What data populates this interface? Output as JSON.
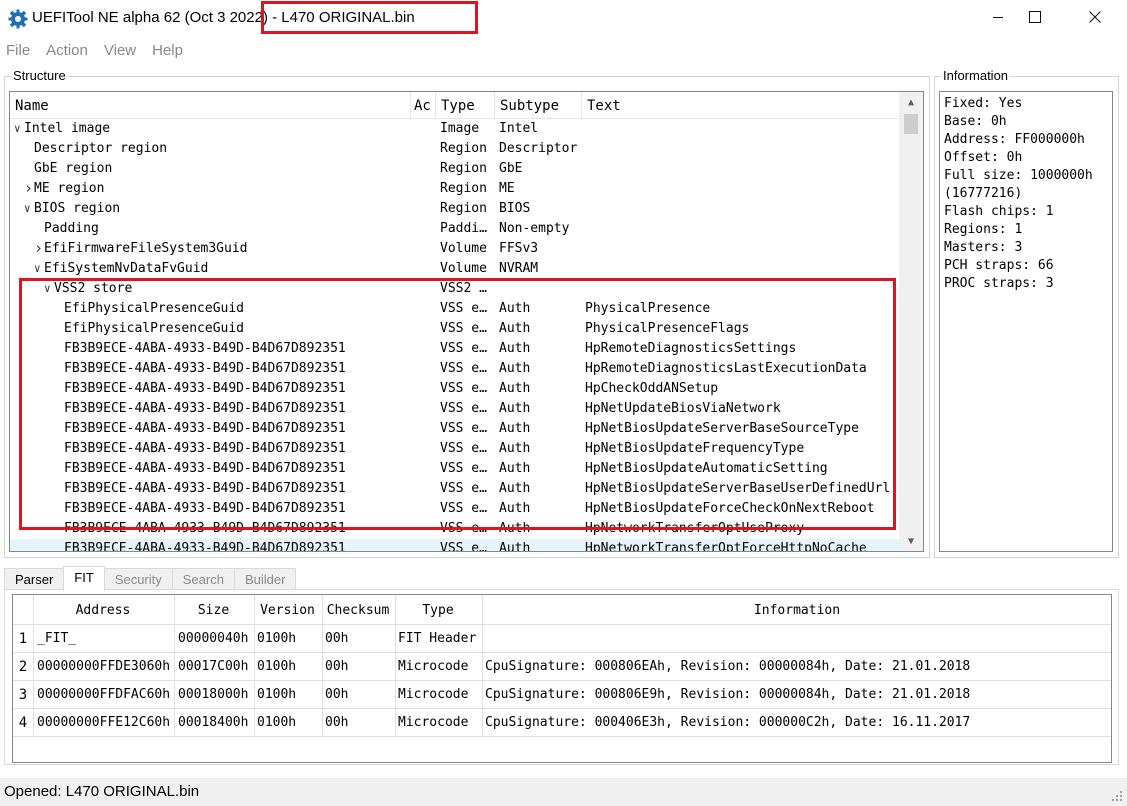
{
  "window": {
    "app_title": "UEFITool NE alpha 62 (Oct  3 2022)",
    "file_suffix": " - L470 ORIGINAL.bin"
  },
  "menu": [
    "File",
    "Action",
    "View",
    "Help"
  ],
  "structure": {
    "group_label": "Structure",
    "columns": [
      "Name",
      "Ac",
      "Type",
      "Subtype",
      "Text"
    ],
    "rows": [
      {
        "arrow": "v",
        "name": "Intel image",
        "type": "Image",
        "subtype": "Intel",
        "text": ""
      },
      {
        "arrow": "",
        "name": "Descriptor region",
        "type": "Region",
        "subtype": "Descriptor",
        "text": ""
      },
      {
        "arrow": "",
        "name": "GbE region",
        "type": "Region",
        "subtype": "GbE",
        "text": ""
      },
      {
        "arrow": ">",
        "name": "ME region",
        "type": "Region",
        "subtype": "ME",
        "text": ""
      },
      {
        "arrow": "v",
        "name": "BIOS region",
        "type": "Region",
        "subtype": "BIOS",
        "text": ""
      },
      {
        "arrow": "",
        "name": "Padding",
        "type": "Paddi…",
        "subtype": "Non-empty",
        "text": ""
      },
      {
        "arrow": ">",
        "name": "EfiFirmwareFileSystem3Guid",
        "type": "Volume",
        "subtype": "FFSv3",
        "text": ""
      },
      {
        "arrow": "v",
        "name": "EfiSystemNvDataFvGuid",
        "type": "Volume",
        "subtype": "NVRAM",
        "text": ""
      },
      {
        "arrow": "v",
        "name": "VSS2 store",
        "type": "VSS2 …",
        "subtype": "",
        "text": ""
      },
      {
        "arrow": "",
        "name": "EfiPhysicalPresenceGuid",
        "type": "VSS e…",
        "subtype": "Auth",
        "text": "PhysicalPresence"
      },
      {
        "arrow": "",
        "name": "EfiPhysicalPresenceGuid",
        "type": "VSS e…",
        "subtype": "Auth",
        "text": "PhysicalPresenceFlags"
      },
      {
        "arrow": "",
        "name": "FB3B9ECE-4ABA-4933-B49D-B4D67D892351",
        "type": "VSS e…",
        "subtype": "Auth",
        "text": "HpRemoteDiagnosticsSettings"
      },
      {
        "arrow": "",
        "name": "FB3B9ECE-4ABA-4933-B49D-B4D67D892351",
        "type": "VSS e…",
        "subtype": "Auth",
        "text": "HpRemoteDiagnosticsLastExecutionData"
      },
      {
        "arrow": "",
        "name": "FB3B9ECE-4ABA-4933-B49D-B4D67D892351",
        "type": "VSS e…",
        "subtype": "Auth",
        "text": "HpCheckOddANSetup"
      },
      {
        "arrow": "",
        "name": "FB3B9ECE-4ABA-4933-B49D-B4D67D892351",
        "type": "VSS e…",
        "subtype": "Auth",
        "text": "HpNetUpdateBiosViaNetwork"
      },
      {
        "arrow": "",
        "name": "FB3B9ECE-4ABA-4933-B49D-B4D67D892351",
        "type": "VSS e…",
        "subtype": "Auth",
        "text": "HpNetBiosUpdateServerBaseSourceType"
      },
      {
        "arrow": "",
        "name": "FB3B9ECE-4ABA-4933-B49D-B4D67D892351",
        "type": "VSS e…",
        "subtype": "Auth",
        "text": "HpNetBiosUpdateFrequencyType"
      },
      {
        "arrow": "",
        "name": "FB3B9ECE-4ABA-4933-B49D-B4D67D892351",
        "type": "VSS e…",
        "subtype": "Auth",
        "text": "HpNetBiosUpdateAutomaticSetting"
      },
      {
        "arrow": "",
        "name": "FB3B9ECE-4ABA-4933-B49D-B4D67D892351",
        "type": "VSS e…",
        "subtype": "Auth",
        "text": "HpNetBiosUpdateServerBaseUserDefinedUrl"
      },
      {
        "arrow": "",
        "name": "FB3B9ECE-4ABA-4933-B49D-B4D67D892351",
        "type": "VSS e…",
        "subtype": "Auth",
        "text": "HpNetBiosUpdateForceCheckOnNextReboot"
      },
      {
        "arrow": "",
        "name": "FB3B9ECE-4ABA-4933-B49D-B4D67D892351",
        "type": "VSS e…",
        "subtype": "Auth",
        "text": "HpNetworkTransferOptUseProxy"
      },
      {
        "arrow": "",
        "name": "FB3B9ECE-4ABA-4933-B49D-B4D67D892351",
        "type": "VSS e…",
        "subtype": "Auth",
        "text": "HpNetworkTransferOptForceHttpNoCache"
      }
    ]
  },
  "information": {
    "group_label": "Information",
    "lines": [
      "Fixed: Yes",
      "Base: 0h",
      "Address: FF000000h",
      "Offset: 0h",
      "Full size: 1000000h",
      "(16777216)",
      "Flash chips: 1",
      "Regions: 1",
      "Masters: 3",
      "PCH straps: 66",
      "PROC straps: 3"
    ]
  },
  "tabs": [
    {
      "label": "Parser",
      "state": "normal"
    },
    {
      "label": "FIT",
      "state": "active"
    },
    {
      "label": "Security",
      "state": "disabled"
    },
    {
      "label": "Search",
      "state": "disabled"
    },
    {
      "label": "Builder",
      "state": "disabled"
    }
  ],
  "fit": {
    "columns": [
      "Address",
      "Size",
      "Version",
      "Checksum",
      "Type",
      "Information"
    ],
    "rows": [
      {
        "num": "1",
        "address": "_FIT_",
        "size": "00000040h",
        "version": "0100h",
        "checksum": "00h",
        "type": "FIT Header",
        "info": ""
      },
      {
        "num": "2",
        "address": "00000000FFDE3060h",
        "size": "00017C00h",
        "version": "0100h",
        "checksum": "00h",
        "type": "Microcode",
        "info": "CpuSignature: 000806EAh, Revision: 00000084h, Date: 21.01.2018"
      },
      {
        "num": "3",
        "address": "00000000FFDFAC60h",
        "size": "00018000h",
        "version": "0100h",
        "checksum": "00h",
        "type": "Microcode",
        "info": "CpuSignature: 000806E9h, Revision: 00000084h, Date: 21.01.2018"
      },
      {
        "num": "4",
        "address": "00000000FFE12C60h",
        "size": "00018400h",
        "version": "0100h",
        "checksum": "00h",
        "type": "Microcode",
        "info": "CpuSignature: 000406E3h, Revision: 000000C2h, Date: 16.11.2017"
      }
    ]
  },
  "status": {
    "text": "Opened: L470 ORIGINAL.bin"
  },
  "colors": {
    "highlight_red": "#e0141e",
    "selection": "#e5f3fb",
    "app_icon": "#1f6fb5"
  },
  "icons": {
    "app": "gear-icon",
    "minimize": "minimize-icon",
    "maximize": "maximize-icon",
    "close": "close-icon"
  }
}
